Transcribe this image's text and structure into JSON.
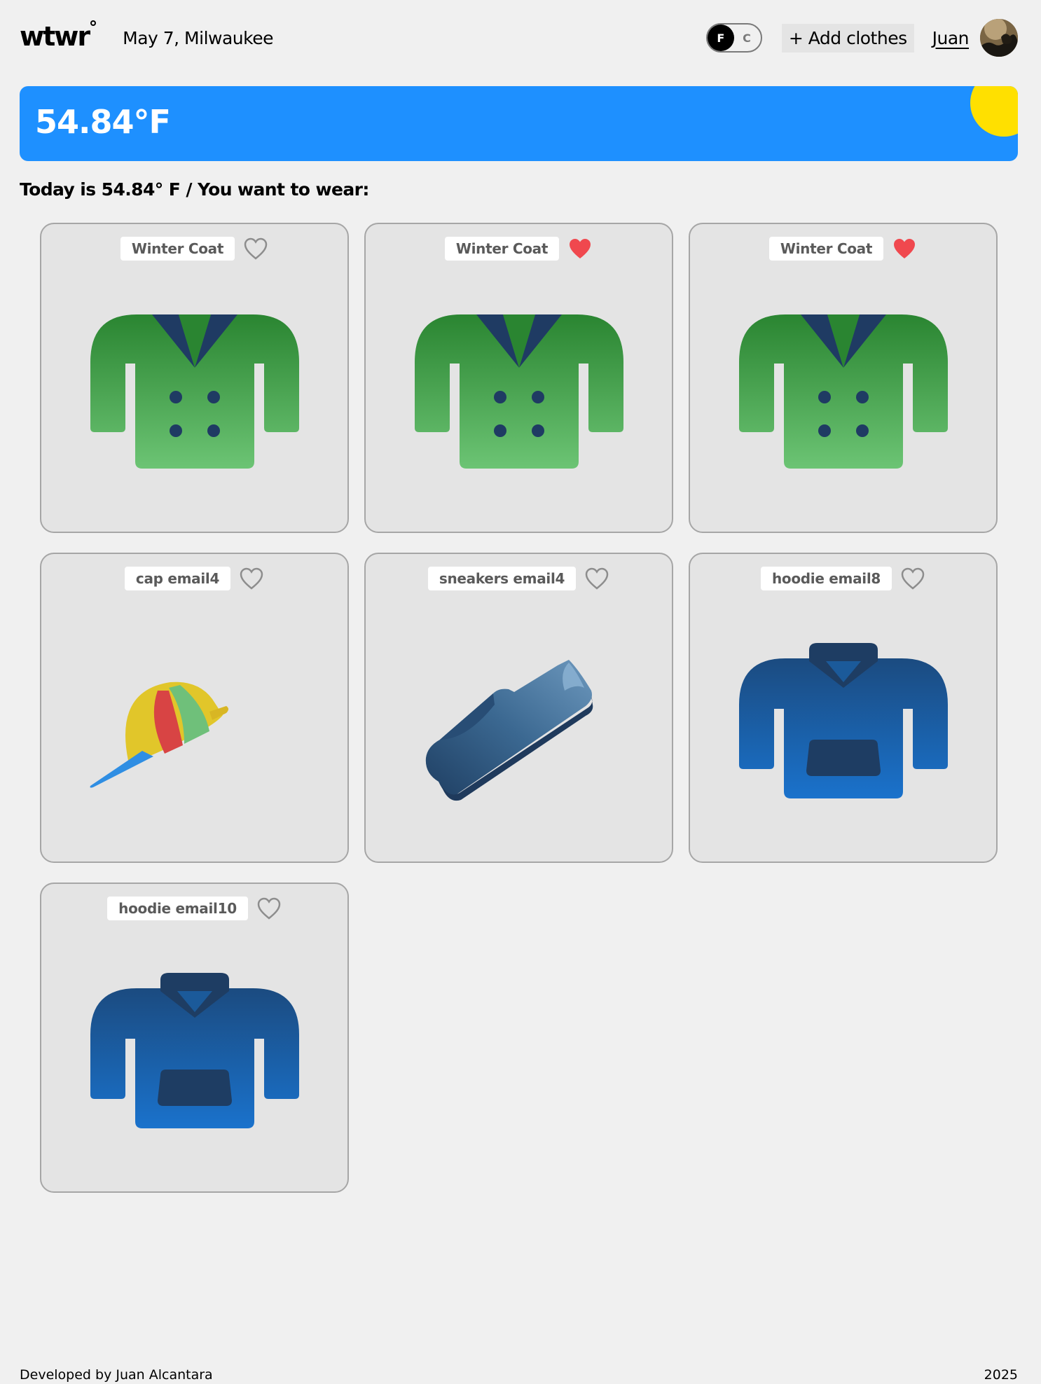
{
  "header": {
    "logo": "wtwr",
    "date_location": "May 7, Milwaukee",
    "toggle": {
      "active": "F",
      "inactive": "C"
    },
    "add_clothes_label": "+ Add clothes",
    "user_name": "Juan"
  },
  "weather": {
    "temperature": "54.84°F",
    "banner_color": "#1e90ff",
    "sun_color": "#ffe000"
  },
  "subtitle": "Today is 54.84° F / You want to wear:",
  "cards": [
    {
      "name": "Winter Coat",
      "liked": false,
      "image": "winter-coat-icon"
    },
    {
      "name": "Winter Coat",
      "liked": true,
      "image": "winter-coat-icon"
    },
    {
      "name": "Winter Coat",
      "liked": true,
      "image": "winter-coat-icon"
    },
    {
      "name": "cap email4",
      "liked": false,
      "image": "cap-icon"
    },
    {
      "name": "sneakers email4",
      "liked": false,
      "image": "sneaker-icon"
    },
    {
      "name": "hoodie email8",
      "liked": false,
      "image": "hoodie-icon"
    },
    {
      "name": "hoodie email10",
      "liked": false,
      "image": "hoodie-icon"
    }
  ],
  "footer": {
    "credit": "Developed by Juan Alcantara",
    "year": "2025"
  }
}
